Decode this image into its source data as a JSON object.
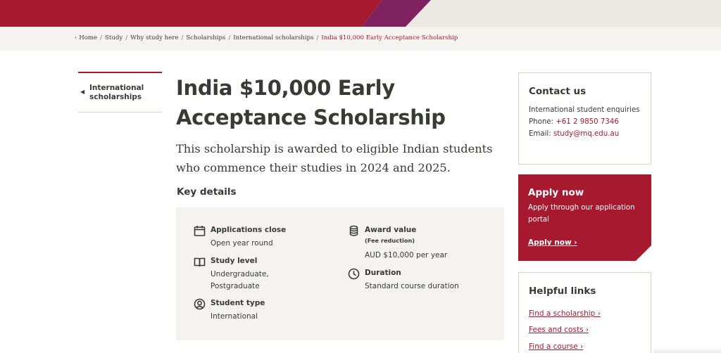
{
  "breadcrumb": {
    "items": [
      "Home",
      "Study",
      "Why study here",
      "Scholarships",
      "International scholarships"
    ],
    "current": "India $10,000 Early Acceptance Scholarship"
  },
  "sidenav": {
    "back_label": "International scholarships"
  },
  "page": {
    "title": "India $10,000 Early Acceptance Scholarship",
    "lead": "This scholarship is awarded to eligible Indian students who commence their studies in 2024 and 2025.",
    "key_details_heading": "Key details"
  },
  "key_details": {
    "applications_close": {
      "title": "Applications close",
      "value": "Open year round"
    },
    "study_level": {
      "title": "Study level",
      "value": "Undergraduate, Postgraduate"
    },
    "student_type": {
      "title": "Student type",
      "value": "International"
    },
    "award_value": {
      "title": "Award value",
      "subtitle": "(Fee reduction)",
      "value": "AUD $10,000 per year"
    },
    "duration": {
      "title": "Duration",
      "value": "Standard course duration"
    }
  },
  "contact": {
    "heading": "Contact us",
    "enquiries": "International student enquiries",
    "phone_label": "Phone:",
    "phone": "+61 2 9850 7346",
    "email_label": "Email:",
    "email": "study@mq.edu.au"
  },
  "apply": {
    "heading": "Apply now",
    "text": "Apply through our application portal",
    "cta": "Apply now ›"
  },
  "helpful_links": {
    "heading": "Helpful links",
    "items": [
      "Find a scholarship ›",
      "Fees and costs ›",
      "Find a course ›"
    ]
  },
  "colors": {
    "brand_red": "#a6192e",
    "brand_purple": "#80225f",
    "sand": "#f4f3ef"
  }
}
